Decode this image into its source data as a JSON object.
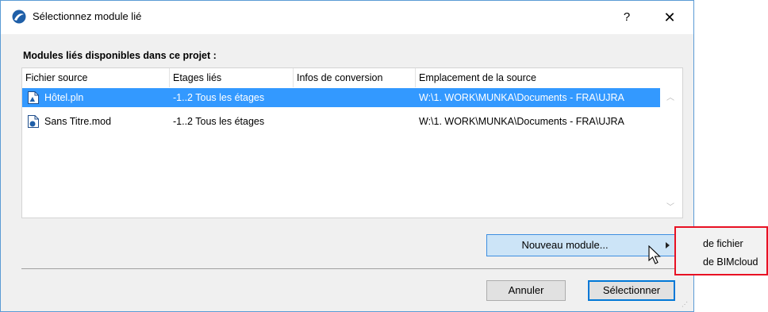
{
  "dialog": {
    "title": "Sélectionnez module lié",
    "help_label": "?",
    "close_label": "✕",
    "section_label": "Modules liés disponibles dans ce projet :"
  },
  "table": {
    "columns": [
      "Fichier source",
      "Etages liés",
      "Infos de conversion",
      "Emplacement de la source"
    ],
    "rows": [
      {
        "file": "Hôtel.pln",
        "floors": "-1..2 Tous les étages",
        "conversion": "",
        "location": "W:\\1. WORK\\MUNKA\\Documents - FRA\\UJRA",
        "selected": true
      },
      {
        "file": "Sans Titre.mod",
        "floors": "-1..2 Tous les étages",
        "conversion": "",
        "location": "W:\\1. WORK\\MUNKA\\Documents - FRA\\UJRA",
        "selected": false
      }
    ]
  },
  "actions": {
    "new_module_label": "Nouveau module...",
    "cancel_label": "Annuler",
    "select_label": "Sélectionner"
  },
  "submenu": {
    "items": [
      "de fichier",
      "de BIMcloud"
    ]
  },
  "colors": {
    "selection": "#3399ff",
    "highlight_frame": "#e81123",
    "button_hover": "#cce4f7",
    "accent": "#0078d7"
  }
}
